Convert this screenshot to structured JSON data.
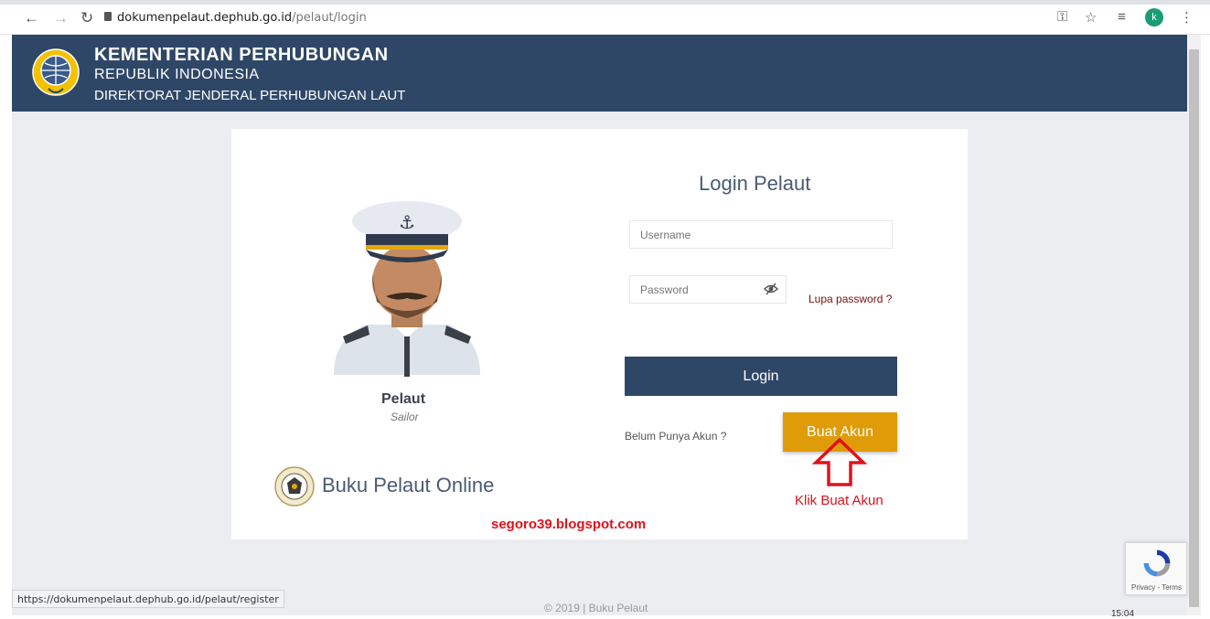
{
  "browser": {
    "url_domain": "dokumenpelaut.dephub.go.id",
    "url_path": "/pelaut/login",
    "avatar_letter": "k",
    "status_url": "https://dokumenpelaut.dephub.go.id/pelaut/register"
  },
  "header": {
    "title": "KEMENTERIAN PERHUBUNGAN",
    "subtitle": "REPUBLIK INDONESIA",
    "department": "DIREKTORAT JENDERAL PERHUBUNGAN LAUT",
    "bg_color": "#2f4767"
  },
  "profile": {
    "label": "Pelaut",
    "sublabel": "Sailor"
  },
  "brand": {
    "name": "Buku Pelaut Online"
  },
  "watermark": "segoro39.blogspot.com",
  "login": {
    "title": "Login Pelaut",
    "username_placeholder": "Username",
    "password_placeholder": "Password",
    "forgot_label": "Lupa password ?",
    "login_button": "Login",
    "no_account_label": "Belum Punya Akun ?",
    "register_button": "Buat Akun",
    "login_color": "#2f4767",
    "register_color": "#e09b08"
  },
  "annotation": {
    "text": "Klik Buat Akun",
    "color": "#d8131b"
  },
  "recaptcha": {
    "label": "Privacy - Terms"
  },
  "footer": {
    "text": "© 2019 | Buku Pelaut"
  },
  "taskbar": {
    "time": "15:04"
  }
}
